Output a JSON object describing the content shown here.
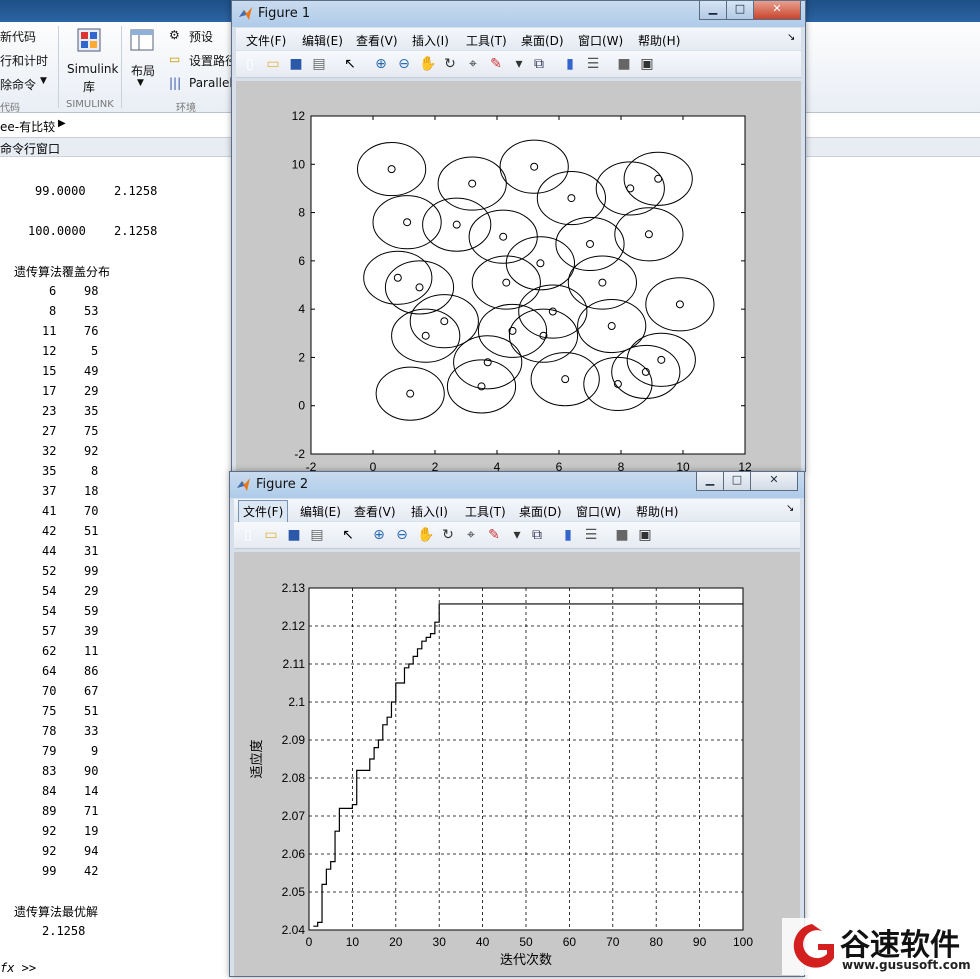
{
  "ribbon": {
    "left_items": [
      "新代码",
      "行和计时",
      "除命令"
    ],
    "section_code": "代码",
    "simulink_label": "Simulink",
    "simulink_lib": "库",
    "section_simulink": "SIMULINK",
    "layout_label": "布局",
    "preset_label": "预设",
    "setpath_label": "设置路径",
    "parallel_label": "Parallel",
    "section_env": "环境"
  },
  "address": {
    "path": "ee-有比较"
  },
  "command_window": {
    "title": "命令行窗口",
    "lines_top": [
      {
        "a": "99.0000",
        "b": "2.1258"
      },
      {
        "a": "100.0000",
        "b": "2.1258"
      }
    ],
    "coverage_heading": "遗传算法覆盖分布",
    "coverage_rows": [
      [
        "6",
        "98"
      ],
      [
        "8",
        "53"
      ],
      [
        "11",
        "76"
      ],
      [
        "12",
        "5"
      ],
      [
        "15",
        "49"
      ],
      [
        "17",
        "29"
      ],
      [
        "23",
        "35"
      ],
      [
        "27",
        "75"
      ],
      [
        "32",
        "92"
      ],
      [
        "35",
        "8"
      ],
      [
        "37",
        "18"
      ],
      [
        "41",
        "70"
      ],
      [
        "42",
        "51"
      ],
      [
        "44",
        "31"
      ],
      [
        "52",
        "99"
      ],
      [
        "54",
        "29"
      ],
      [
        "54",
        "59"
      ],
      [
        "57",
        "39"
      ],
      [
        "62",
        "11"
      ],
      [
        "64",
        "86"
      ],
      [
        "70",
        "67"
      ],
      [
        "75",
        "51"
      ],
      [
        "78",
        "33"
      ],
      [
        "79",
        "9"
      ],
      [
        "83",
        "90"
      ],
      [
        "84",
        "14"
      ],
      [
        "89",
        "71"
      ],
      [
        "92",
        "19"
      ],
      [
        "92",
        "94"
      ],
      [
        "99",
        "42"
      ]
    ],
    "best_heading": "遗传算法最优解",
    "best_value": "2.1258",
    "prompt": "fx >>"
  },
  "menus": [
    "文件(F)",
    "编辑(E)",
    "查看(V)",
    "插入(I)",
    "工具(T)",
    "桌面(D)",
    "窗口(W)",
    "帮助(H)"
  ],
  "figure1": {
    "title": "Figure 1",
    "chart_data": {
      "type": "scatter",
      "xlim": [
        -2,
        12
      ],
      "ylim": [
        -2,
        12
      ],
      "xticks": [
        -2,
        0,
        2,
        4,
        6,
        8,
        10,
        12
      ],
      "yticks": [
        -2,
        0,
        2,
        4,
        6,
        8,
        10,
        12
      ],
      "circle_radius": 1.1,
      "points": [
        [
          0.6,
          9.8
        ],
        [
          3.2,
          9.2
        ],
        [
          5.2,
          9.9
        ],
        [
          6.4,
          8.6
        ],
        [
          8.3,
          9.0
        ],
        [
          9.2,
          9.4
        ],
        [
          1.1,
          7.6
        ],
        [
          2.7,
          7.5
        ],
        [
          4.2,
          7.0
        ],
        [
          7.0,
          6.7
        ],
        [
          8.9,
          7.1
        ],
        [
          0.8,
          5.3
        ],
        [
          1.5,
          4.9
        ],
        [
          4.3,
          5.1
        ],
        [
          5.4,
          5.9
        ],
        [
          7.4,
          5.1
        ],
        [
          2.3,
          3.5
        ],
        [
          1.7,
          2.9
        ],
        [
          4.5,
          3.1
        ],
        [
          5.5,
          2.9
        ],
        [
          5.8,
          3.9
        ],
        [
          7.7,
          3.3
        ],
        [
          9.9,
          4.2
        ],
        [
          3.7,
          1.8
        ],
        [
          6.2,
          1.1
        ],
        [
          8.8,
          1.4
        ],
        [
          9.3,
          1.9
        ],
        [
          3.5,
          0.8
        ],
        [
          7.9,
          0.9
        ],
        [
          1.2,
          0.5
        ]
      ]
    }
  },
  "figure2": {
    "title": "Figure 2",
    "chart_data": {
      "type": "line",
      "xlabel": "迭代次数",
      "ylabel": "适应度",
      "xlim": [
        0,
        100
      ],
      "ylim": [
        2.04,
        2.13
      ],
      "xticks": [
        0,
        10,
        20,
        30,
        40,
        50,
        60,
        70,
        80,
        90,
        100
      ],
      "yticks": [
        2.04,
        2.05,
        2.06,
        2.07,
        2.08,
        2.09,
        2.1,
        2.11,
        2.12,
        2.13
      ],
      "grid": true,
      "series": [
        {
          "x": [
            1,
            2,
            3,
            4,
            5,
            6,
            7,
            8,
            9,
            10,
            11,
            12,
            13,
            14,
            15,
            16,
            17,
            18,
            19,
            20,
            21,
            22,
            23,
            24,
            25,
            26,
            27,
            28,
            29,
            30,
            100
          ],
          "y": [
            2.041,
            2.042,
            2.052,
            2.056,
            2.058,
            2.066,
            2.072,
            2.072,
            2.072,
            2.073,
            2.082,
            2.082,
            2.082,
            2.085,
            2.088,
            2.09,
            2.094,
            2.096,
            2.1,
            2.105,
            2.105,
            2.109,
            2.11,
            2.112,
            2.114,
            2.116,
            2.117,
            2.118,
            2.121,
            2.1258,
            2.1258
          ]
        }
      ]
    }
  },
  "watermark": {
    "brand": "谷速软件",
    "url": "www.gususoft.com"
  }
}
